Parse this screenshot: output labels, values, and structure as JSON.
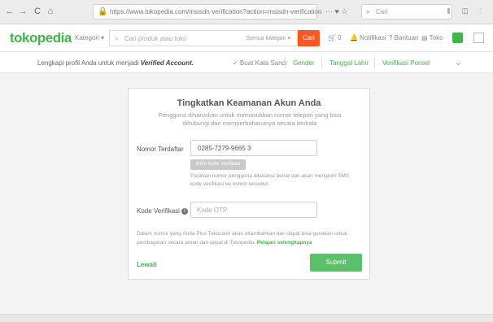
{
  "browser": {
    "back": "←",
    "forward": "→",
    "reload": "C",
    "home": "⌂",
    "url": "https://www.tokopedia.com/msisdn-verification?action=msisdn-verification",
    "url_actions": "··· ♥ ☆",
    "search_placeholder": "Cari",
    "right_icons": "⫴ ◫ ⋮"
  },
  "header": {
    "logo": "tokopedia",
    "kategori": "Kategori ▾",
    "search_placeholder": "Cari produk atau toko",
    "search_category": "Semua kategori ▾",
    "search_button": "Cari",
    "cart": "🛒 0",
    "notifikasi": "🔔 Notifikasi",
    "bantuan": "? Bantuan",
    "toko": "▤ Toko"
  },
  "profile_bar": {
    "prefix": "Lengkapi profil Anda untuk menjadi",
    "highlight": "Verified Account.",
    "buat_kata_sandi": "✓ Buat Kata Sandi",
    "gender": "Gender",
    "tanggal_lahir": "Tanggal Lahir",
    "verifikasi_ponsel": "Verifikasi Ponsel",
    "chevron": "⌄"
  },
  "card": {
    "title": "Tingkatkan Keamanan Akun Anda",
    "description": "Pengguna diharuskan untuk memasukkan nomor telepon yang bisa dihubungi dan memperbaharuinya secara berkala",
    "nomor_label": "Nomor Terdaftar",
    "nomor_value": "0285-7279-9665 3",
    "send_button": "Kirim Kode Verifikasi (SMS)",
    "hint": "Pastikan nomor pengguna diketahui benar dan akan mengirim SMS kode verifikasi ke nomor tersebut.",
    "kode_label": "Kode Verifikasi",
    "kode_placeholder": "Kode OTP",
    "note": "Dalam nomor yang Anda Plus Tokocash akan ditambahkan dan dapat bisa gunakan untuk pembayaran secara aman dan cepat di Tokopedia.",
    "note_link": "Pelajari selengkapnya",
    "back": "Lewati",
    "submit": "Submit"
  },
  "colors": {
    "brand_green": "#42b549",
    "submit_green": "#5cbf6a",
    "search_orange": "#ff5722"
  }
}
